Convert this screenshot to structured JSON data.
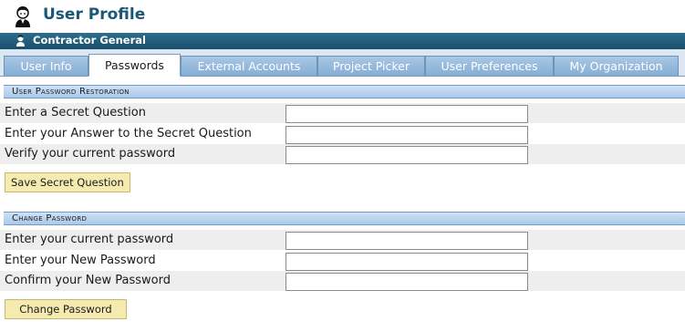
{
  "header": {
    "title": "User Profile",
    "avatar_icon": "user-avatar-icon"
  },
  "role_bar": {
    "label": "Contractor General",
    "icon": "user-small-icon"
  },
  "tabs": [
    {
      "label": "User Info",
      "active": false
    },
    {
      "label": "Passwords",
      "active": true
    },
    {
      "label": "External Accounts",
      "active": false
    },
    {
      "label": "Project Picker",
      "active": false
    },
    {
      "label": "User Preferences",
      "active": false
    },
    {
      "label": "My Organization",
      "active": false
    }
  ],
  "restoration": {
    "title": "User Password Restoration",
    "rows": [
      {
        "label": "Enter a Secret Question",
        "value": ""
      },
      {
        "label": "Enter your Answer to the Secret Question",
        "value": ""
      },
      {
        "label": "Verify your current password",
        "value": ""
      }
    ],
    "button": "Save Secret Question"
  },
  "change_password": {
    "title": "Change Password",
    "rows": [
      {
        "label": "Enter your current password",
        "value": ""
      },
      {
        "label": "Enter your New Password",
        "value": ""
      },
      {
        "label": "Confirm your New Password",
        "value": ""
      }
    ],
    "button": "Change Password"
  },
  "colors": {
    "title": "#1a5777",
    "role_bar": "#1f5a78",
    "tab_inactive": "#93b8dc",
    "section_header": "#b9d3ee",
    "button": "#f5ebb0"
  }
}
